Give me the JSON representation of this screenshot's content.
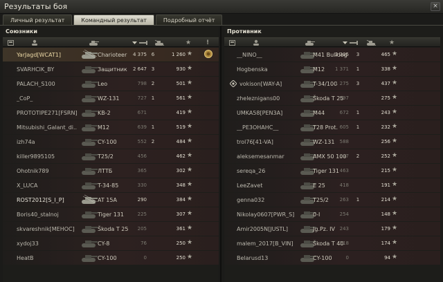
{
  "window": {
    "title": "Результаты боя",
    "close_glyph": "×"
  },
  "tabs": [
    {
      "label": "Личный результат",
      "active": false
    },
    {
      "label": "Командный результат",
      "active": true
    },
    {
      "label": "Подробный отчёт",
      "active": false
    }
  ],
  "allies": {
    "title": "Союзники",
    "rows": [
      {
        "name": "YarJagd[WCAT1]",
        "vehicle": "Charioteer",
        "damage": "4 375",
        "kills": "6",
        "xp": "1 260",
        "player": true
      },
      {
        "name": "SVARHCIK_BY",
        "vehicle": "Защитник",
        "damage": "2 647",
        "kills": "3",
        "xp": "930"
      },
      {
        "name": "PALACH_S100",
        "vehicle": "Leo",
        "damage": "798",
        "kills": "2",
        "xp": "501"
      },
      {
        "name": "_CoP_",
        "vehicle": "WZ-131",
        "damage": "727",
        "kills": "1",
        "xp": "561"
      },
      {
        "name": "PROTOTIPE271[FSRN]",
        "vehicle": "KB-2",
        "damage": "671",
        "kills": "",
        "xp": "419"
      },
      {
        "name": "Mitsubishi_Galant_di..",
        "vehicle": "M12",
        "damage": "639",
        "kills": "1",
        "xp": "519"
      },
      {
        "name": "izh74a",
        "vehicle": "CY-100",
        "damage": "552",
        "kills": "2",
        "xp": "484"
      },
      {
        "name": "killer9895105",
        "vehicle": "T25/2",
        "damage": "456",
        "kills": "",
        "xp": "462"
      },
      {
        "name": "Ohotnik789",
        "vehicle": "ЛТТБ",
        "damage": "365",
        "kills": "",
        "xp": "302"
      },
      {
        "name": "X_LUCA",
        "vehicle": "T-34-85",
        "damage": "330",
        "kills": "",
        "xp": "348"
      },
      {
        "name": "ROST2012[S_I_P]",
        "vehicle": "AT 15A",
        "damage": "290",
        "kills": "",
        "xp": "384",
        "highlight": true
      },
      {
        "name": "Boris40_stalnoj",
        "vehicle": "Tiger 131",
        "damage": "225",
        "kills": "",
        "xp": "307"
      },
      {
        "name": "skvareshnik[MEHOC]",
        "vehicle": "Škoda T 25",
        "damage": "205",
        "kills": "",
        "xp": "361"
      },
      {
        "name": "xydoj33",
        "vehicle": "CY-8",
        "damage": "76",
        "kills": "",
        "xp": "250"
      },
      {
        "name": "HeatB",
        "vehicle": "CY-100",
        "damage": "0",
        "kills": "",
        "xp": "250"
      }
    ]
  },
  "enemies": {
    "title": "Противник",
    "rows": [
      {
        "name": "__NINO__",
        "vehicle": "M41 Bulldog",
        "damage": "2 305",
        "kills": "3",
        "xp": "465"
      },
      {
        "name": "Hogbenska",
        "vehicle": "M12",
        "damage": "1 371",
        "kills": "1",
        "xp": "338"
      },
      {
        "name": "vokison[WAY-A]",
        "vehicle": "T-34/100",
        "damage": "1 275",
        "kills": "3",
        "xp": "437",
        "clan": true
      },
      {
        "name": "zheleznigans00",
        "vehicle": "Škoda T 25",
        "damage": "897",
        "kills": "",
        "xp": "275"
      },
      {
        "name": "UMKA58[PEN3A]",
        "vehicle": "M44",
        "damage": "672",
        "kills": "1",
        "xp": "243"
      },
      {
        "name": "__PE3OHAHC__",
        "vehicle": "T28 Prot.",
        "damage": "605",
        "kills": "1",
        "xp": "232"
      },
      {
        "name": "trol76[41-VA]",
        "vehicle": "WZ-131",
        "damage": "588",
        "kills": "",
        "xp": "256"
      },
      {
        "name": "aleksemesanmar",
        "vehicle": "AMX 50 100",
        "damage": "547",
        "kills": "2",
        "xp": "252"
      },
      {
        "name": "sereqa_26",
        "vehicle": "Tiger 131",
        "damage": "463",
        "kills": "",
        "xp": "215"
      },
      {
        "name": "LeeZavet",
        "vehicle": "E 25",
        "damage": "418",
        "kills": "",
        "xp": "191"
      },
      {
        "name": "genna032",
        "vehicle": "T25/2",
        "damage": "263",
        "kills": "1",
        "xp": "214"
      },
      {
        "name": "Nikolay0607[PWR_S]",
        "vehicle": "0-I",
        "damage": "254",
        "kills": "",
        "xp": "148"
      },
      {
        "name": "Amir2005N[JUSTL]",
        "vehicle": "Jg.Pz. IV",
        "damage": "243",
        "kills": "",
        "xp": "179"
      },
      {
        "name": "malem_2017[B_VIN]",
        "vehicle": "Škoda T 40",
        "damage": "218",
        "kills": "",
        "xp": "174"
      },
      {
        "name": "Belarusd13",
        "vehicle": "CY-100",
        "damage": "0",
        "kills": "",
        "xp": "94"
      }
    ]
  },
  "colors": {
    "player_row": "#3e3528",
    "row_bg": "#2d2120",
    "header": "#34342f"
  },
  "icons": [
    "close-icon",
    "vehicle-class-icon",
    "player-icon",
    "tank-icon",
    "damage-icon",
    "kills-icon",
    "xp-star-icon",
    "medal-icon",
    "clan-emblem-icon"
  ],
  "star_glyph": "★"
}
